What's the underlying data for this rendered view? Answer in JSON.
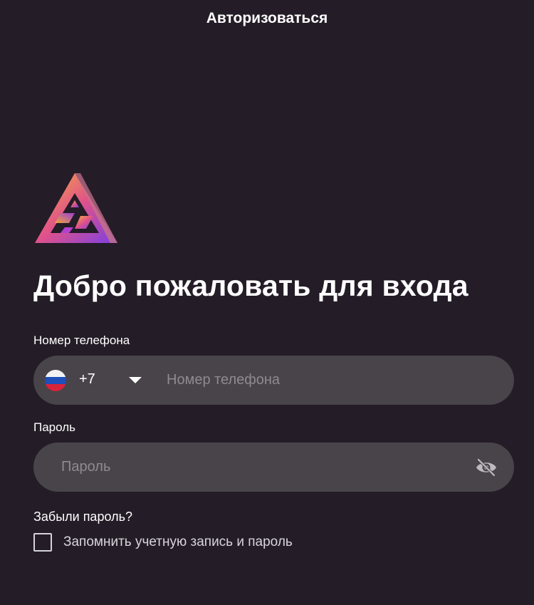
{
  "header": {
    "title": "Авторизоваться"
  },
  "welcome": {
    "heading": "Добро пожаловать для входа"
  },
  "phone": {
    "label": "Номер телефона",
    "country_flag": "russia-flag",
    "dial_code": "+7",
    "placeholder": "Номер телефона",
    "value": ""
  },
  "password": {
    "label": "Пароль",
    "placeholder": "Пароль",
    "value": "",
    "visibility_icon": "eye-off-icon"
  },
  "forgot_link": "Забыли пароль?",
  "remember": {
    "label": "Запомнить учетную запись и пароль",
    "checked": false
  },
  "colors": {
    "background": "#241c27",
    "field_background": "#49444a",
    "text": "#ffffff",
    "placeholder": "#8e8a90",
    "logo_gradient": [
      "#f7b23b",
      "#e0528a",
      "#7b3fe4"
    ]
  }
}
